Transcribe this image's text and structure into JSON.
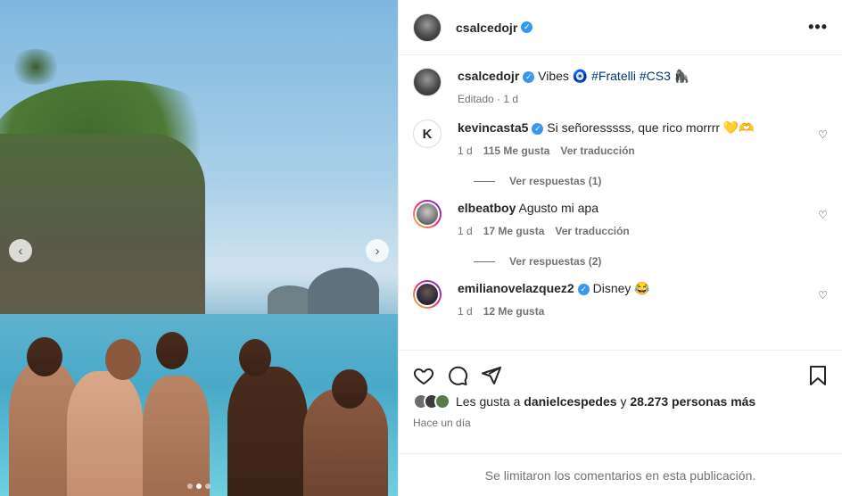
{
  "post_owner": {
    "username": "csalcedojr",
    "verified_glyph": "✓"
  },
  "header": {
    "more_label": "•••"
  },
  "caption": {
    "username": "csalcedojr",
    "text": "Vibes 🧿 ",
    "hashtag1": "#Fratelli",
    "hashtag2": "#CS3",
    "emoji": "🦍",
    "edited": "Editado · 1 d"
  },
  "comments": [
    {
      "username": "kevincasta5",
      "text": "Si señoresssss, que rico morrrr 💛🫶",
      "age": "1 d",
      "likes": "115 Me gusta",
      "translate": "Ver traducción",
      "replies": "Ver respuestas (1)"
    },
    {
      "username": "elbeatboy",
      "text": "Agusto mi apa",
      "age": "1 d",
      "likes": "17 Me gusta",
      "translate": "Ver traducción",
      "replies": "Ver respuestas (2)"
    },
    {
      "username": "emilianovelazquez2",
      "text": "Disney 😂",
      "age": "1 d",
      "likes": "12 Me gusta"
    }
  ],
  "actions": {
    "like_icon": "heart-icon",
    "comment_icon": "comment-icon",
    "share_icon": "share-icon",
    "save_icon": "bookmark-icon"
  },
  "likes": {
    "prefix": "Les gusta a ",
    "user": "danielcespedes",
    "middle": " y ",
    "count": "28.273 personas más"
  },
  "post_time": "Hace un día",
  "comments_closed": "Se limitaron los comentarios en esta publicación.",
  "carousel": {
    "prev_label": "‹",
    "next_label": "›"
  },
  "colors": {
    "verified": "#3897f0",
    "hashtag": "#00376b",
    "muted": "#737373"
  }
}
